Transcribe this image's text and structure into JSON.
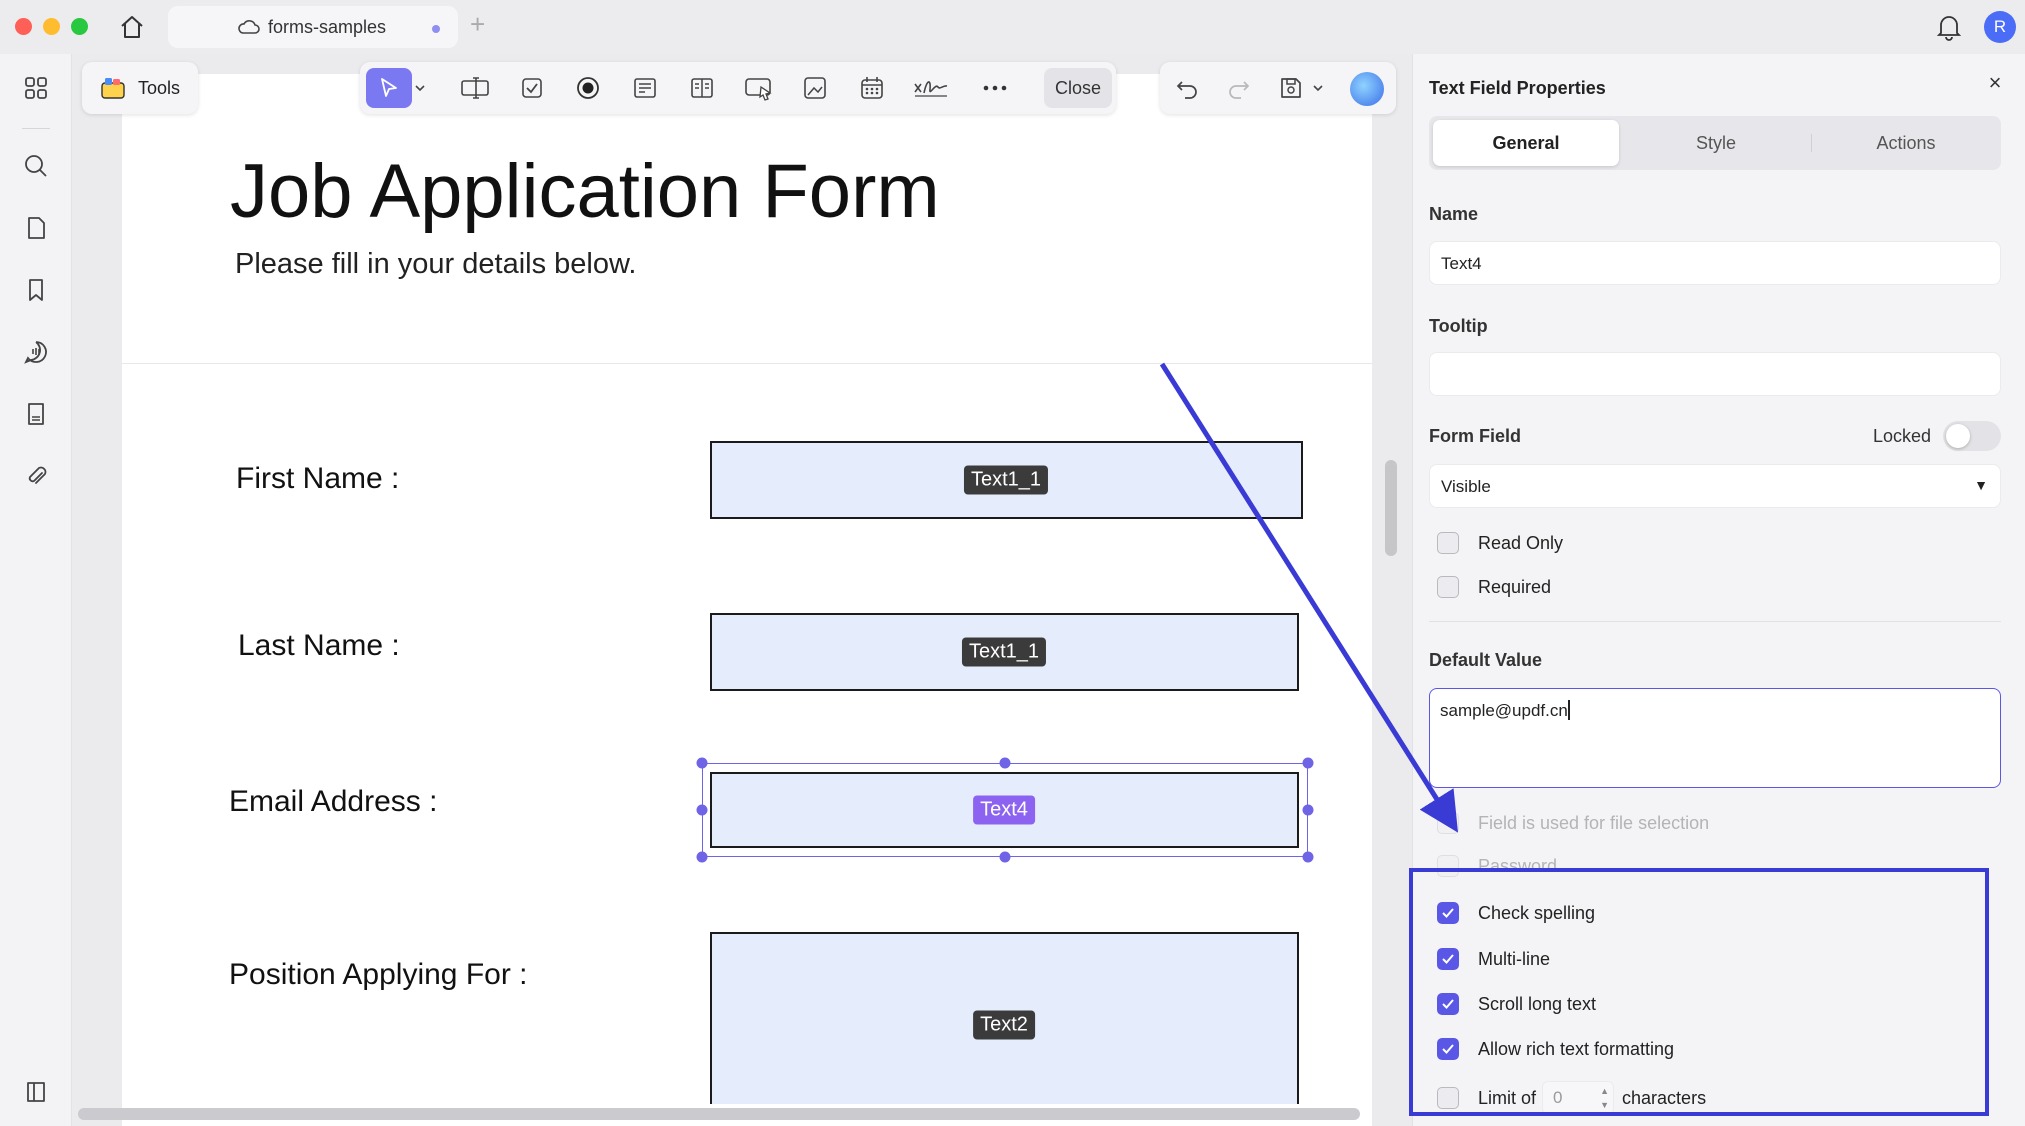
{
  "window": {
    "tab_title": "forms-samples",
    "avatar_initial": "R"
  },
  "toolbar": {
    "tools_label": "Tools",
    "close_label": "Close"
  },
  "document": {
    "title": "Job Application Form",
    "subtitle": "Please fill in your details below.",
    "fields": [
      {
        "label": "First Name :",
        "tag": "Text1_1"
      },
      {
        "label": "Last Name :",
        "tag": "Text1_1"
      },
      {
        "label": "Email Address :",
        "tag": "Text4",
        "selected": true
      },
      {
        "label": "Position Applying For :",
        "tag": "Text2"
      }
    ]
  },
  "panel": {
    "title": "Text Field Properties",
    "tabs": [
      "General",
      "Style",
      "Actions"
    ],
    "active_tab": "General",
    "name_label": "Name",
    "name_value": "Text4",
    "tooltip_label": "Tooltip",
    "tooltip_value": "",
    "form_field_label": "Form Field",
    "locked_label": "Locked",
    "locked": false,
    "visibility_value": "Visible",
    "read_only_label": "Read Only",
    "read_only": false,
    "required_label": "Required",
    "required": false,
    "default_value_label": "Default Value",
    "default_value": "sample@updf.cn",
    "file_selection_label": "Field is used for file selection",
    "password_label": "Password",
    "check_spelling_label": "Check spelling",
    "check_spelling": true,
    "multiline_label": "Multi-line",
    "multiline": true,
    "scroll_label": "Scroll long text",
    "scroll": true,
    "rich_text_label": "Allow rich text formatting",
    "rich_text": true,
    "limit_label": "Limit of",
    "limit_value": "0",
    "characters_label": "characters",
    "limit_enabled": false
  },
  "colors": {
    "accent": "#5b57e6",
    "selection": "#8c63f0",
    "field_fill": "#e5edfd",
    "annotation": "#3a3ad4"
  }
}
